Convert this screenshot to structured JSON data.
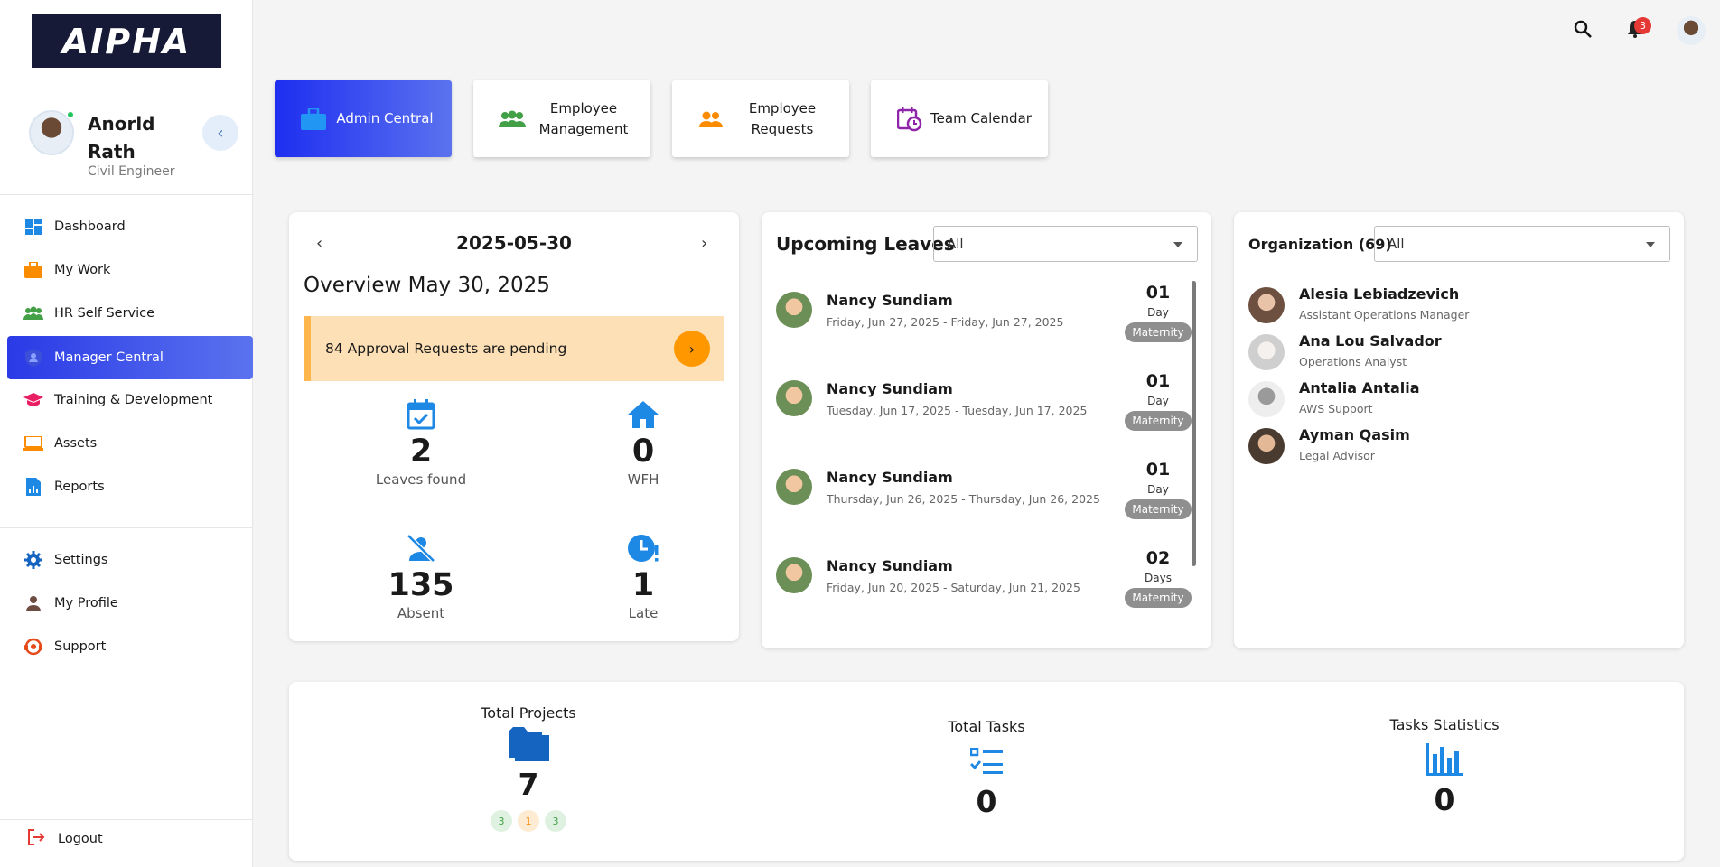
{
  "app": {
    "logo_text": "AIPHA"
  },
  "profile": {
    "name": "Anorld Rath",
    "role": "Civil Engineer"
  },
  "sidebar": {
    "items": [
      {
        "label": "Dashboard",
        "icon": "dashboard-icon"
      },
      {
        "label": "My Work",
        "icon": "briefcase-icon"
      },
      {
        "label": "HR Self Service",
        "icon": "people-icon"
      },
      {
        "label": "Manager Central",
        "icon": "shield-person-icon"
      },
      {
        "label": "Training & Development",
        "icon": "graduation-cap-icon"
      },
      {
        "label": "Assets",
        "icon": "laptop-icon"
      },
      {
        "label": "Reports",
        "icon": "report-icon"
      },
      {
        "label": "Settings",
        "icon": "gear-icon"
      },
      {
        "label": "My Profile",
        "icon": "person-icon"
      },
      {
        "label": "Support",
        "icon": "support-icon"
      }
    ],
    "logout": "Logout"
  },
  "topbar": {
    "notification_count": "3"
  },
  "tiles": [
    {
      "label": "Admin Central",
      "icon": "briefcase-icon"
    },
    {
      "label": "Employee Management",
      "icon": "group-icon"
    },
    {
      "label": "Employee Requests",
      "icon": "people-icon"
    },
    {
      "label": "Team Calendar",
      "icon": "calendar-clock-icon"
    }
  ],
  "overview": {
    "date": "2025-05-30",
    "title": "Overview May 30, 2025",
    "alert": "84 Approval Requests are pending",
    "stats": [
      {
        "value": "2",
        "label": "Leaves found"
      },
      {
        "value": "0",
        "label": "WFH"
      },
      {
        "value": "135",
        "label": "Absent"
      },
      {
        "value": "1",
        "label": "Late"
      }
    ]
  },
  "leaves": {
    "title": "Upcoming Leaves",
    "filter": "All",
    "items": [
      {
        "name": "Nancy Sundiam",
        "dates": "Friday, Jun 27, 2025 - Friday, Jun 27, 2025",
        "count": "01",
        "unit": "Day",
        "type": "Maternity"
      },
      {
        "name": "Nancy Sundiam",
        "dates": "Tuesday, Jun 17, 2025 - Tuesday, Jun 17, 2025",
        "count": "01",
        "unit": "Day",
        "type": "Maternity"
      },
      {
        "name": "Nancy Sundiam",
        "dates": "Thursday, Jun 26, 2025 - Thursday, Jun 26, 2025",
        "count": "01",
        "unit": "Day",
        "type": "Maternity"
      },
      {
        "name": "Nancy Sundiam",
        "dates": "Friday, Jun 20, 2025 - Saturday, Jun 21, 2025",
        "count": "02",
        "unit": "Days",
        "type": "Maternity"
      }
    ]
  },
  "organization": {
    "title": "Organization (69)",
    "filter": "All",
    "members": [
      {
        "name": "Alesia Lebiadzevich",
        "role": "Assistant Operations Manager"
      },
      {
        "name": "Ana Lou Salvador",
        "role": "Operations Analyst"
      },
      {
        "name": "Antalia Antalia",
        "role": "AWS Support"
      },
      {
        "name": "Ayman Qasim",
        "role": "Legal Advisor"
      }
    ]
  },
  "summary": {
    "projects": {
      "title": "Total Projects",
      "value": "7",
      "chips": [
        "3",
        "1",
        "3"
      ]
    },
    "tasks": {
      "title": "Total Tasks",
      "value": "0"
    },
    "statistics": {
      "title": "Tasks Statistics",
      "value": "0"
    }
  },
  "colors": {
    "accent": "#2a3ae6",
    "alert_bg": "#fde0b6",
    "alert_btn": "#ff9800",
    "stat_icon": "#1e88e5",
    "tag": "#8f8f8f"
  }
}
